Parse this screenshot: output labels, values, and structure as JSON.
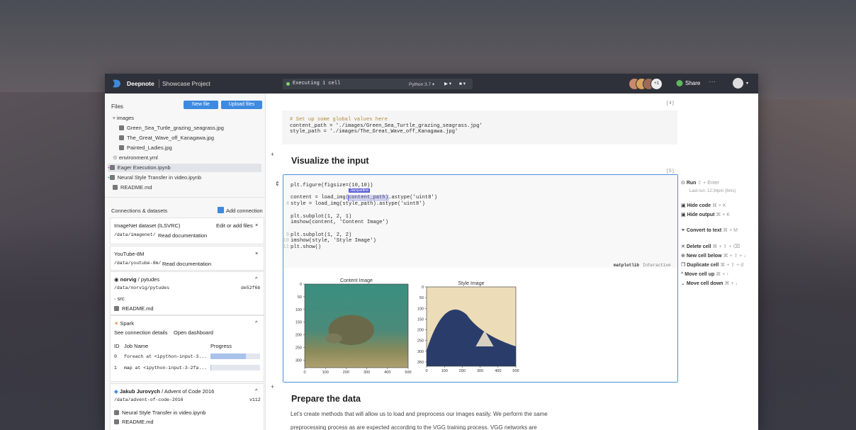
{
  "app": {
    "brand": "Deepnote",
    "project": "Showcase Project"
  },
  "topbar": {
    "status": "Executing 1 cell",
    "kernel": "Python 3.7 ▾",
    "run_btn": "▶ ▾",
    "stop_btn": "■ ▾",
    "avatar_more": "+1",
    "share": "Share",
    "more": "···",
    "user_caret": "▾"
  },
  "files": {
    "title": "Files",
    "new_file": "New file",
    "upload": "Upload files",
    "tree": [
      {
        "label": "images",
        "kind": "folder"
      },
      {
        "label": "Green_Sea_Turtle_grazing_seagrass.jpg",
        "kind": "file"
      },
      {
        "label": "The_Great_Wave_off_Kanagawa.jpg",
        "kind": "file"
      },
      {
        "label": "Painted_Ladies.jpg",
        "kind": "file"
      },
      {
        "label": "environment.yml",
        "kind": "gear"
      },
      {
        "label": "Eager Execution.ipynb",
        "kind": "notebook"
      },
      {
        "label": "Neural Style Transfer in video.ipynb",
        "kind": "notebook"
      },
      {
        "label": "README.md",
        "kind": "file"
      }
    ]
  },
  "connections": {
    "title": "Connections & datasets",
    "add": "Add connection",
    "imagenet": {
      "name": "ImageNet dataset (ILSVRC)",
      "path": "/data/imagenet/",
      "doc": "Read documentation",
      "action": "Edit or add files",
      "close": "×"
    },
    "youtube": {
      "name": "YouTube-8M",
      "path": "/data/youtube-8m/",
      "doc": "Read documentation",
      "close": "×"
    },
    "github": {
      "owner": "norvig",
      "repo": "pytudes",
      "path": "/data/norvig/pytudes",
      "commit": "de52f6b",
      "caret": "^",
      "items": [
        "src",
        "README.md"
      ]
    },
    "spark": {
      "name": "Spark",
      "details": "See connection details",
      "dashboard": "Open dashboard",
      "caret": "^",
      "col_id": "ID",
      "col_job": "Job Name",
      "col_progress": "Progress",
      "jobs": [
        {
          "id": "0",
          "name": "foreach at <ipython-input-3...",
          "progress": 0.72
        },
        {
          "id": "1",
          "name": "map at <ipython-input-3-2fa...",
          "progress": 0.02
        }
      ]
    },
    "aoc": {
      "owner": "Jakub Jurovych",
      "repo": "Advent of Code 2016",
      "path": "/data/advent-of-code-2016",
      "tag": "v112",
      "caret": "^",
      "items": [
        "Neural Style Transfer in video.ipynb",
        "README.md"
      ]
    }
  },
  "notebook": {
    "cell1": {
      "counter": "[4]",
      "lines": [
        "# Set up some global values here",
        "content_path = './images/Green_Sea_Turtle_grazing_seagrass.jpg'",
        "style_path = './images/The_Great_Wave_off_Kanagawa.jpg'"
      ]
    },
    "heading1": "Visualize the input",
    "cell2": {
      "counter": "[5]",
      "cursor_user": "Jacqueline",
      "lines": [
        "plt.figure(figsize=(10,10))",
        "",
        "content = load_img(content_path).astype('uint8')",
        "style = load_img(style_path).astype('uint8')",
        "",
        "plt.subplot(1, 2, 1)",
        "imshow(content, 'Content Image')",
        "",
        "plt.subplot(1, 2, 2)",
        "imshow(style, 'Style Image')",
        "plt.show()"
      ],
      "line_numbers": [
        "",
        "",
        "",
        "4",
        "",
        "",
        "",
        "",
        "9",
        "10",
        "11"
      ],
      "badge_lib": "matplotlib",
      "badge_mode": "Interactive"
    },
    "heading2": "Prepare the data",
    "para1": "Let's create methods that will allow us to load and preprocess our images easily. We perform the same",
    "para2": "preprocessing process as are expected according to the VGG training process. VGG networks are"
  },
  "cell_menu": {
    "run": "Run",
    "run_kbd": "⇧ + Enter",
    "last_run": "Last run: 12:34pm (6ms)",
    "hide_code": "Hide code",
    "hide_code_kbd": "⌘ + K",
    "hide_output": "Hide output",
    "hide_output_kbd": "⌘ + K",
    "convert": "Convert to text",
    "convert_kbd": "⌘ + M",
    "delete": "Delete cell",
    "delete_kbd": "⌘ + ⇧ + ⌫",
    "new_below": "New cell below",
    "new_below_kbd": "⌘ + ⇧ + ↓",
    "duplicate": "Duplicate cell",
    "duplicate_kbd": "⌘ + ⇧ + d",
    "move_up": "Move cell up",
    "move_up_kbd": "⌘ + ↑",
    "move_down": "Move cell down",
    "move_down_kbd": "⌘ + ↓"
  },
  "plots": {
    "content": {
      "title": "Content Image",
      "yticks": [
        "0",
        "50",
        "100",
        "150",
        "200",
        "250",
        "300"
      ],
      "xticks": [
        "0",
        "100",
        "200",
        "300",
        "400",
        "500"
      ],
      "ylim": [
        0,
        330
      ],
      "xlim": [
        0,
        500
      ]
    },
    "style": {
      "title": "Style Image",
      "yticks": [
        "0",
        "50",
        "100",
        "150",
        "200",
        "250",
        "300",
        "350"
      ],
      "xticks": [
        "0",
        "100",
        "200",
        "300",
        "400",
        "500"
      ],
      "ylim": [
        0,
        370
      ],
      "xlim": [
        0,
        500
      ]
    }
  },
  "colors": {
    "accent": "#3d8ae0",
    "topbar": "#2e3139",
    "selection": "#4a90e2"
  }
}
